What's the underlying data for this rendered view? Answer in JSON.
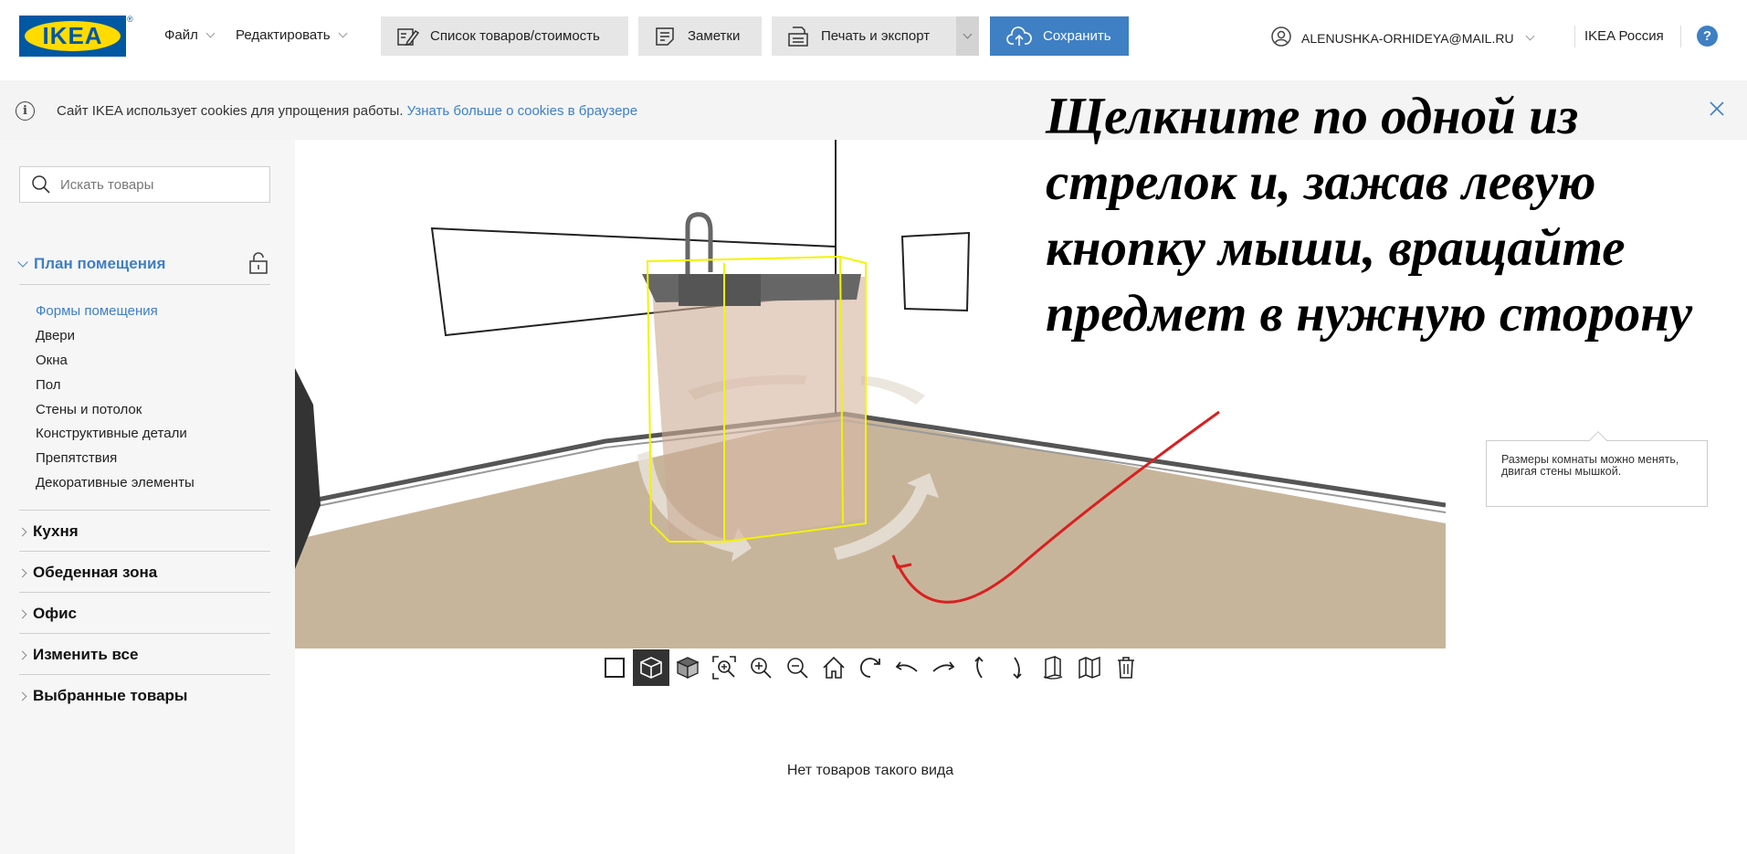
{
  "header": {
    "logo_text": "IKEA",
    "logo_reg": "®",
    "menu": [
      {
        "label": "Файл"
      },
      {
        "label": "Редактировать"
      }
    ],
    "buttons": {
      "list_cost": "Список товаров/стоимость",
      "notes": "Заметки",
      "print_export": "Печать и экспорт",
      "save": "Сохранить"
    },
    "user_email": "ALENUSHKA-ORHIDEYA@MAIL.RU",
    "country": "IKEA Россия",
    "help": "?"
  },
  "cookie_bar": {
    "text": "Сайт IKEA использует cookies для упрощения работы.",
    "link": "Узнать больше о cookies в браузере"
  },
  "sidebar": {
    "search_placeholder": "Искать товары",
    "sections": [
      {
        "label": "План помещения",
        "open": true,
        "items": [
          "Формы помещения",
          "Двери",
          "Окна",
          "Пол",
          "Стены и потолок",
          "Конструктивные детали",
          "Препятствия",
          "Декоративные элементы"
        ],
        "active_item": "Формы помещения"
      },
      {
        "label": "Кухня",
        "open": false
      },
      {
        "label": "Обеденная зона",
        "open": false
      },
      {
        "label": "Офис",
        "open": false
      },
      {
        "label": "Изменить все",
        "open": false
      },
      {
        "label": "Выбранные товары",
        "open": false
      }
    ]
  },
  "canvas": {
    "instruction": "Щелкните по одной из стрелок и, зажав левую кнопку мыши, вращайте предмет в нужную сторону",
    "tooltip": "Размеры комнаты можно менять, двигая стены мышкой."
  },
  "view_toolbar": {
    "tools": [
      {
        "name": "view-2d-icon",
        "active": false
      },
      {
        "name": "view-3d-icon",
        "active": true
      },
      {
        "name": "view-3d-solid-icon",
        "active": false
      },
      {
        "name": "zoom-fit-icon",
        "active": false
      },
      {
        "name": "zoom-in-icon",
        "active": false
      },
      {
        "name": "zoom-out-icon",
        "active": false
      },
      {
        "name": "home-icon",
        "active": false
      },
      {
        "name": "rotate-icon",
        "active": false
      },
      {
        "name": "rotate-left-icon",
        "active": false
      },
      {
        "name": "rotate-right-icon",
        "active": false
      },
      {
        "name": "tilt-up-icon",
        "active": false
      },
      {
        "name": "tilt-down-icon",
        "active": false
      },
      {
        "name": "walls-icon",
        "active": false
      },
      {
        "name": "walls-hide-icon",
        "active": false
      },
      {
        "name": "trash-icon",
        "active": false
      }
    ]
  },
  "empty_message": "Нет товаров такого вида",
  "colors": {
    "accent": "#3f7fc4",
    "ikea_blue": "#0058a3",
    "ikea_yellow": "#ffdb00",
    "floor": "#c7b59b",
    "selection": "#f3f300",
    "annotation_arrow": "#d92020"
  }
}
